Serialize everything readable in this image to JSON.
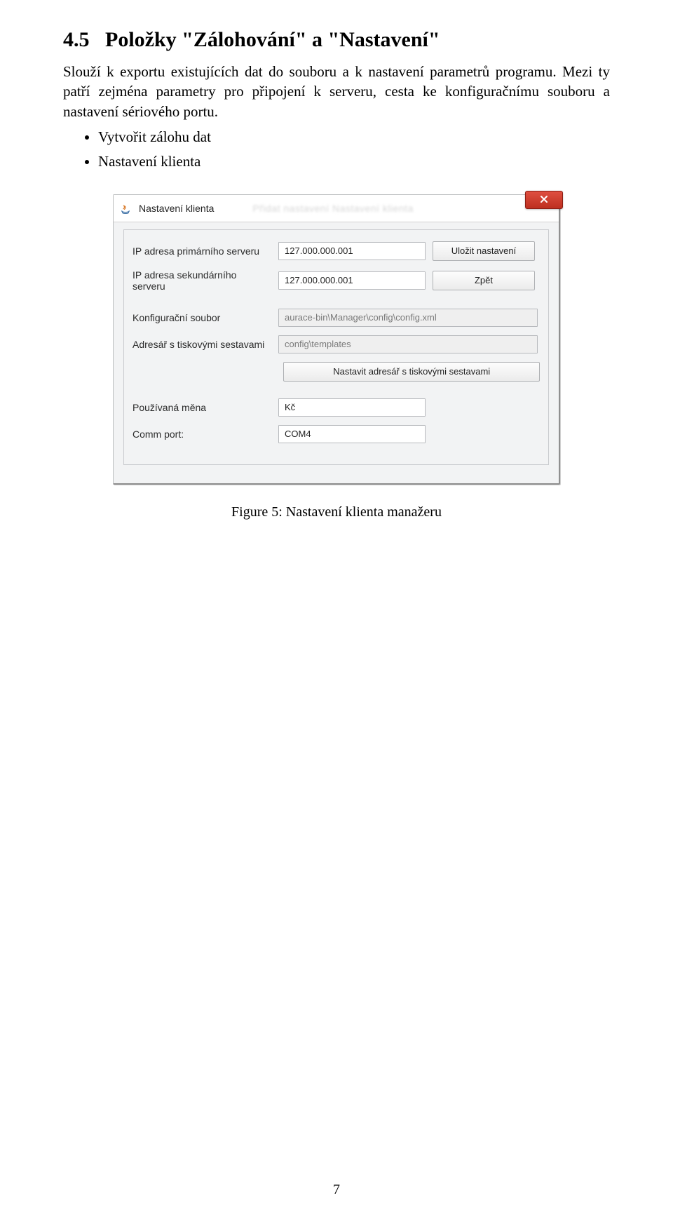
{
  "section": {
    "number": "4.5",
    "title": "Položky \"Zálohování\" a \"Nastavení\"",
    "paragraph": "Slouží k exportu existujících dat do souboru a k nastavení parametrů programu. Mezi ty patří zejména parametry pro připojení k serveru, cesta ke konfiguračnímu souboru a nastavení sériového portu.",
    "bullets": [
      "Vytvořit zálohu dat",
      "Nastavení klienta"
    ]
  },
  "dialog": {
    "window_title": "Nastavení klienta",
    "blur_text": "Přidat nastavení   Nastavení klienta",
    "rows": {
      "ip_primary_label": "IP adresa primárního serveru",
      "ip_primary_value": "127.000.000.001",
      "ip_secondary_label": "IP adresa sekundárního serveru",
      "ip_secondary_value": "127.000.000.001",
      "config_label": "Konfigurační soubor",
      "config_value": "aurace-bin\\Manager\\config\\config.xml",
      "templates_label": "Adresář s tiskovými sestavami",
      "templates_value": "config\\templates",
      "currency_label": "Používaná měna",
      "currency_value": "Kč",
      "comm_label": "Comm port:",
      "comm_value": "COM4"
    },
    "buttons": {
      "save": "Uložit nastavení",
      "back": "Zpět",
      "set_dir": "Nastavit adresář s tiskovými sestavami"
    }
  },
  "figure": {
    "caption": "Figure 5: Nastavení klienta manažeru"
  },
  "page_number": "7"
}
